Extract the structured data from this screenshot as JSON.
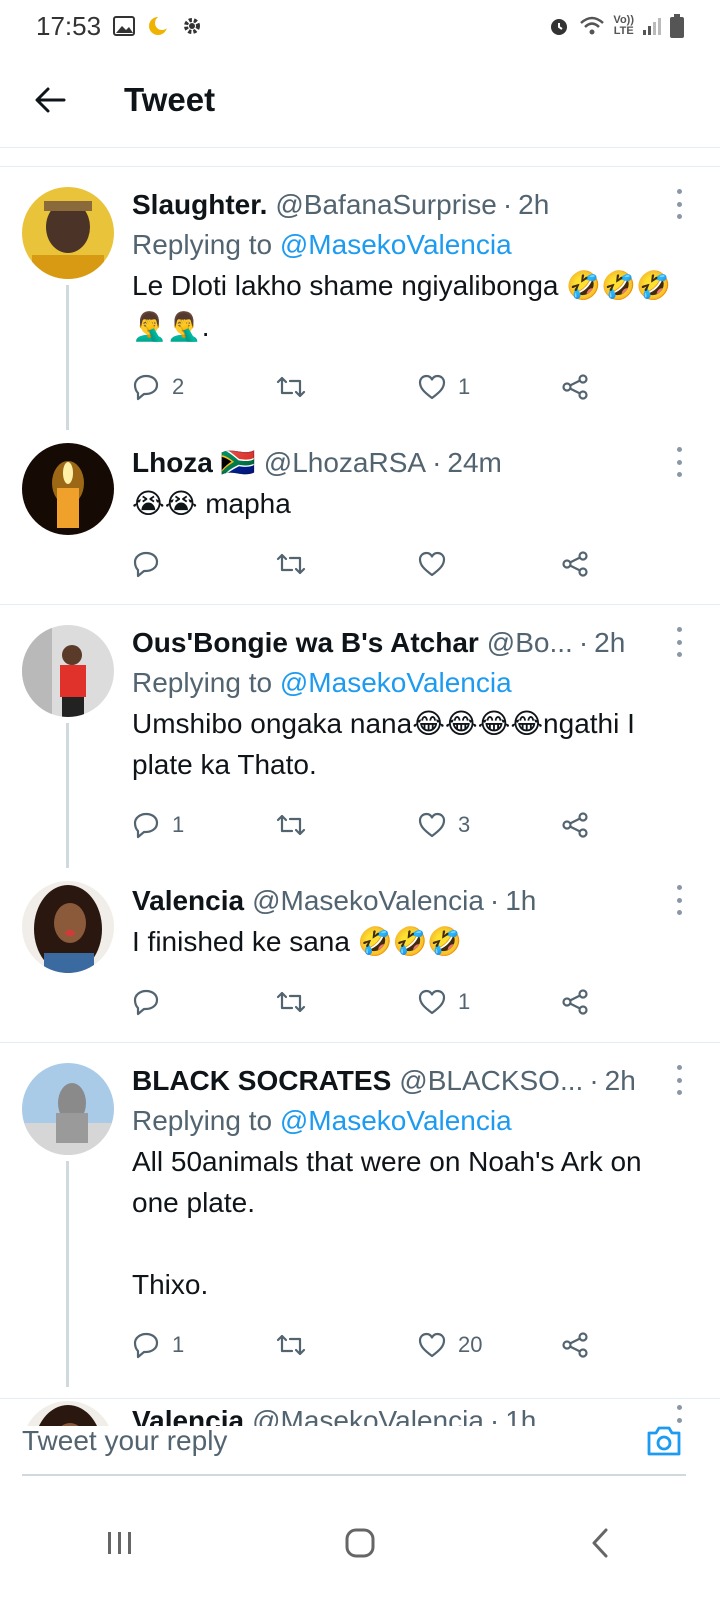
{
  "status_bar": {
    "time": "17:53",
    "left_icons": [
      "image-icon",
      "moon-icon",
      "gear-icon"
    ],
    "right_icons": [
      "alarm-icon",
      "wifi-icon",
      "volte-icon",
      "signal-icon",
      "battery-icon"
    ],
    "volte_label": "Vo))\nLTE"
  },
  "header": {
    "title": "Tweet"
  },
  "tweets": [
    {
      "name": "Slaughter.",
      "handle": "@BafanaSurprise",
      "time": "2h",
      "replying_prefix": "Replying to",
      "replying_to": "@MasekoValencia",
      "text": "Le Dloti lakho shame ngiyalibonga 🤣🤣🤣🤦‍♂️🤦‍♂️.",
      "replies": "2",
      "likes": "1",
      "avatar_colors": [
        "#d7a41a",
        "#4b3a2a"
      ]
    },
    {
      "name": "Lhoza",
      "flag": "🇿🇦",
      "handle": "@LhozaRSA",
      "time": "24m",
      "text": "😭😭 mapha",
      "replies": "",
      "likes": "",
      "avatar_colors": [
        "#1a0d05",
        "#f2a122"
      ]
    },
    {
      "name": "Ous'Bongie wa B's Atchar",
      "handle": "@Bo...",
      "time": "2h",
      "replying_prefix": "Replying to",
      "replying_to": "@MasekoValencia",
      "text": "Umshibo ongaka nana😂😂😂😂ngathi I plate ka Thato.",
      "replies": "1",
      "likes": "3",
      "avatar_colors": [
        "#d9d9d9",
        "#e0322a"
      ]
    },
    {
      "name": "Valencia",
      "handle": "@MasekoValencia",
      "time": "1h",
      "text": "I finished ke sana 🤣🤣🤣",
      "replies": "",
      "likes": "1",
      "avatar_colors": [
        "#3a2418",
        "#d23a3a"
      ]
    },
    {
      "name": "BLACK SOCRATES",
      "handle": "@BLACKSO...",
      "time": "2h",
      "replying_prefix": "Replying to",
      "replying_to": "@MasekoValencia",
      "text": "All 50animals that were on Noah's Ark on one plate.\n\nThixo.",
      "replies": "1",
      "likes": "20",
      "avatar_colors": [
        "#a9cbe8",
        "#8a8a8a"
      ]
    },
    {
      "name": "Valencia",
      "handle": "@MasekoValencia",
      "time": "1h",
      "text": "🤣🤣🤣",
      "avatar_colors": [
        "#3a2418",
        "#d23a3a"
      ]
    }
  ],
  "reply_bar": {
    "placeholder": "Tweet your reply"
  },
  "colors": {
    "link": "#1d9bf0",
    "muted": "#536471",
    "divider": "#e6ecf0",
    "thread": "#cfd9de"
  }
}
